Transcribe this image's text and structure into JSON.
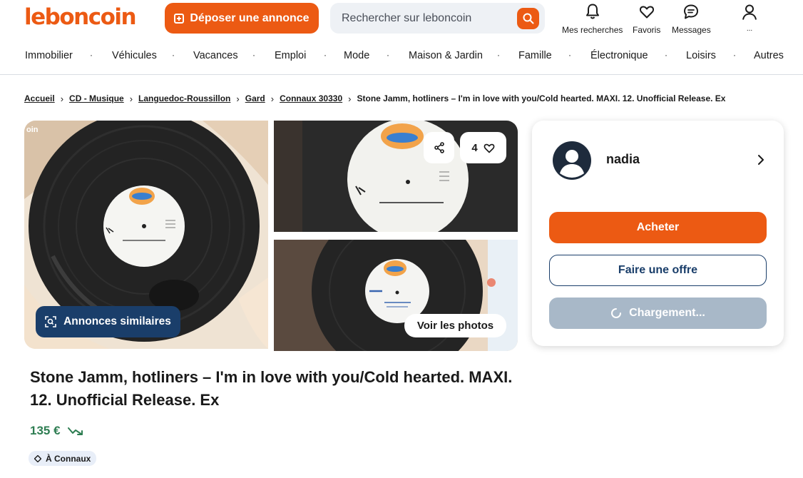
{
  "header": {
    "logo_text": "leboncoin",
    "deposit_label": "Déposer une annonce",
    "search_placeholder": "Rechercher sur leboncoin",
    "actions": {
      "searches": "Mes recherches",
      "favorites": "Favoris",
      "messages": "Messages",
      "account": "..."
    }
  },
  "nav": {
    "items": [
      "Immobilier",
      "Véhicules",
      "Vacances",
      "Emploi",
      "Mode",
      "Maison & Jardin",
      "Famille",
      "Électronique",
      "Loisirs",
      "Autres"
    ],
    "separator": "·"
  },
  "breadcrumb": {
    "items": [
      "Accueil",
      "CD - Musique",
      "Languedoc-Roussillon",
      "Gard",
      "Connaux 30330"
    ],
    "current": "Stone Jamm, hotliners – I'm in love with you/Cold hearted. MAXI. 12. Unofficial Release. Ex",
    "separator": "›"
  },
  "gallery": {
    "similar_label": "Annonces similaires",
    "see_photos_label": "Voir les photos",
    "favorites_count": "4",
    "photo_corner_text": "oin"
  },
  "listing": {
    "title": "Stone Jamm, hotliners – I'm in love with you/Cold hearted. MAXI. 12. Unofficial Release. Ex",
    "price": "135 €",
    "location": "À Connaux"
  },
  "seller": {
    "name": "nadia",
    "buy_label": "Acheter",
    "offer_label": "Faire une offre",
    "loading_label": "Chargement..."
  },
  "colors": {
    "brand": "#ec5a13",
    "navy": "#1a3e6a",
    "price_green": "#2e7d52"
  }
}
